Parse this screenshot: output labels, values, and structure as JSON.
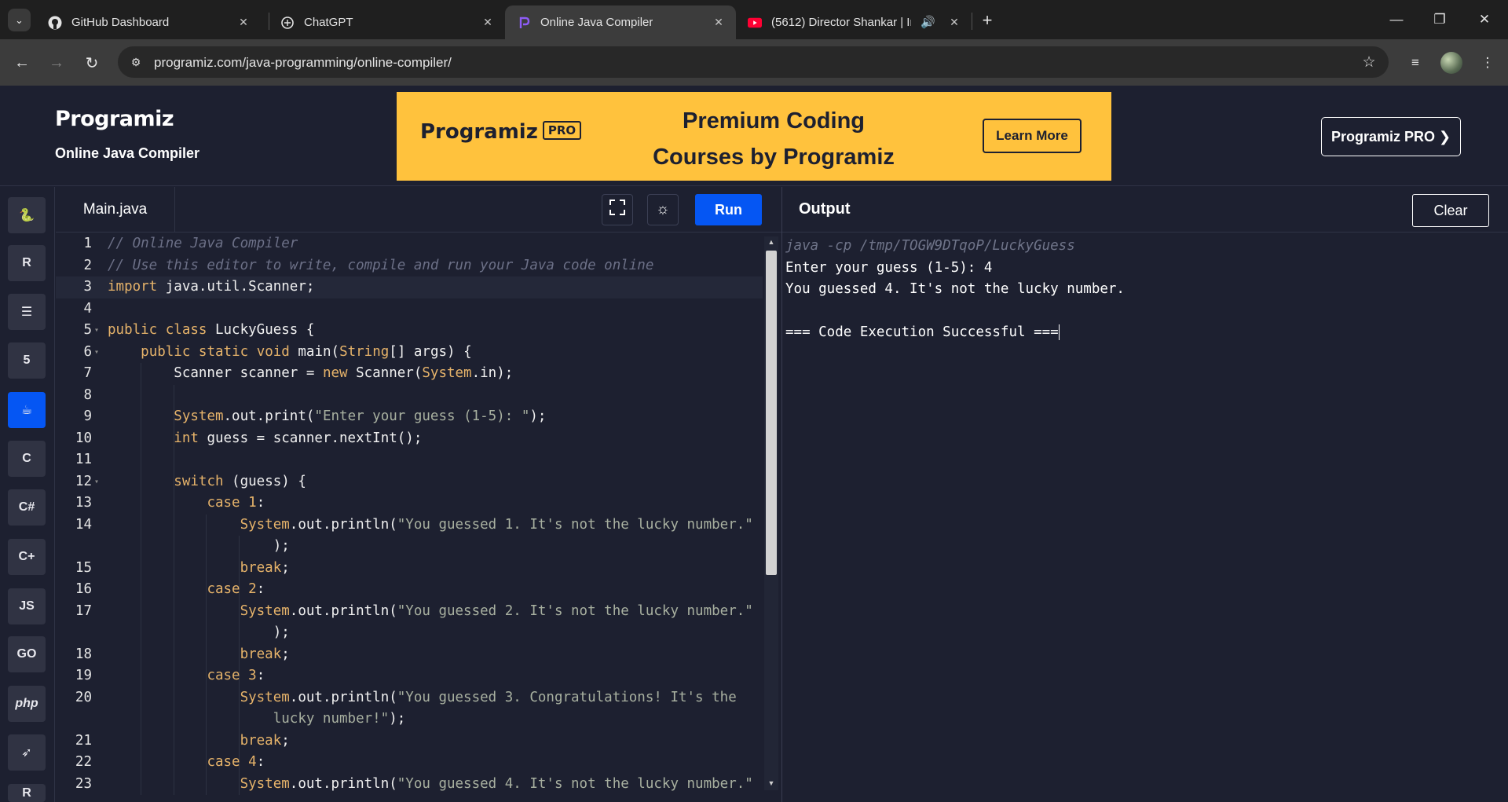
{
  "browser": {
    "tabs": [
      {
        "title": "GitHub Dashboard",
        "icon": "github-icon",
        "active": false
      },
      {
        "title": "ChatGPT",
        "icon": "chatgpt-icon",
        "active": false
      },
      {
        "title": "Online Java Compiler",
        "icon": "programiz-icon",
        "active": true
      },
      {
        "title": "(5612) Director Shankar | In",
        "icon": "youtube-icon",
        "active": false
      }
    ],
    "url": "programiz.com/java-programming/online-compiler/"
  },
  "header": {
    "logo": "Programiz",
    "subtitle": "Online Java Compiler",
    "banner": {
      "logo": "Programiz",
      "logo_badge": "PRO",
      "headline_line1": "Premium Coding",
      "headline_line2": "Courses by Programiz",
      "cta": "Learn More",
      "color": "#ffc23d"
    },
    "pro_button": "Programiz PRO ❯"
  },
  "languages": [
    {
      "name": "python-icon",
      "glyph": "🐍",
      "active": false
    },
    {
      "name": "r-icon",
      "glyph": "R",
      "active": false
    },
    {
      "name": "sql-icon",
      "glyph": "☰",
      "active": false
    },
    {
      "name": "html-icon",
      "glyph": "5",
      "active": false
    },
    {
      "name": "java-icon",
      "glyph": "☕",
      "active": true
    },
    {
      "name": "c-icon",
      "glyph": "C",
      "active": false
    },
    {
      "name": "csharp-icon",
      "glyph": "C#",
      "active": false
    },
    {
      "name": "cpp-icon",
      "glyph": "C+",
      "active": false
    },
    {
      "name": "js-icon",
      "glyph": "JS",
      "active": false
    },
    {
      "name": "go-icon",
      "glyph": "GO",
      "active": false
    },
    {
      "name": "php-icon",
      "glyph": "php",
      "active": false
    },
    {
      "name": "swift-icon",
      "glyph": "➶",
      "active": false
    },
    {
      "name": "rust-icon",
      "glyph": "R",
      "active": false
    }
  ],
  "editor": {
    "file_tab": "Main.java",
    "run_label": "Run",
    "accent": "#0556f3",
    "lines": [
      {
        "n": "1",
        "code": "// Online Java Compiler",
        "comment": true
      },
      {
        "n": "2",
        "code": "// Use this editor to write, compile and run your Java code online",
        "comment": true
      },
      {
        "n": "3",
        "code": "import java.util.Scanner;",
        "fold": false,
        "hl": true
      },
      {
        "n": "4",
        "code": ""
      },
      {
        "n": "5",
        "code": "public class LuckyGuess {",
        "fold": true
      },
      {
        "n": "6",
        "code": "    public static void main(String[] args) {",
        "fold": true
      },
      {
        "n": "7",
        "code": "        Scanner scanner = new Scanner(System.in);"
      },
      {
        "n": "8",
        "code": ""
      },
      {
        "n": "9",
        "code": "        System.out.print(\"Enter your guess (1-5): \");"
      },
      {
        "n": "10",
        "code": "        int guess = scanner.nextInt();"
      },
      {
        "n": "11",
        "code": ""
      },
      {
        "n": "12",
        "code": "        switch (guess) {",
        "fold": true
      },
      {
        "n": "13",
        "code": "            case 1:"
      },
      {
        "n": "14",
        "code": "                System.out.println(\"You guessed 1. It's not the lucky number.\""
      },
      {
        "n": "",
        "code": "                    );"
      },
      {
        "n": "15",
        "code": "                break;"
      },
      {
        "n": "16",
        "code": "            case 2:"
      },
      {
        "n": "17",
        "code": "                System.out.println(\"You guessed 2. It's not the lucky number.\""
      },
      {
        "n": "",
        "code": "                    );"
      },
      {
        "n": "18",
        "code": "                break;"
      },
      {
        "n": "19",
        "code": "            case 3:"
      },
      {
        "n": "20",
        "code": "                System.out.println(\"You guessed 3. Congratulations! It's the"
      },
      {
        "n": "",
        "code": "                    lucky number!\");"
      },
      {
        "n": "21",
        "code": "                break;"
      },
      {
        "n": "22",
        "code": "            case 4:"
      },
      {
        "n": "23",
        "code": "                System.out.println(\"You guessed 4. It's not the lucky number.\""
      }
    ]
  },
  "output": {
    "title": "Output",
    "clear_label": "Clear",
    "command": "java -cp /tmp/TOGW9DTqoP/LuckyGuess",
    "lines": [
      "Enter your guess (1-5): 4",
      "You guessed 4. It's not the lucky number.",
      "",
      "=== Code Execution Successful ==="
    ]
  }
}
